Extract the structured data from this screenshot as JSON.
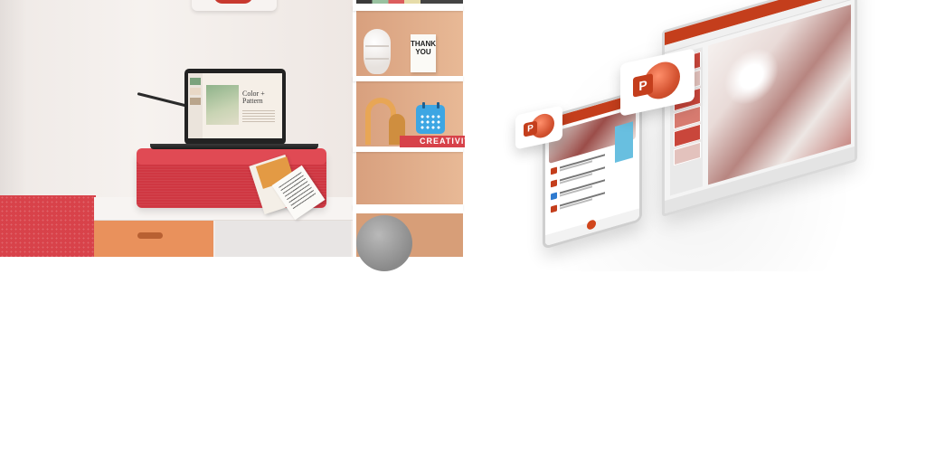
{
  "left_photo": {
    "laptop_slide_title": "Color + Pattern",
    "card_text": "THANK YOU",
    "shelf_label": "CREATIVITY"
  },
  "right_devices": {
    "app_icon_letter": "P"
  },
  "colors": {
    "powerpoint_orange": "#c43e1c",
    "accent_red": "#d7424a",
    "drawer_orange": "#e9915c",
    "calendar_blue": "#3da6e3"
  },
  "icons": [
    "powerpoint-app-icon",
    "calendar-icon"
  ]
}
